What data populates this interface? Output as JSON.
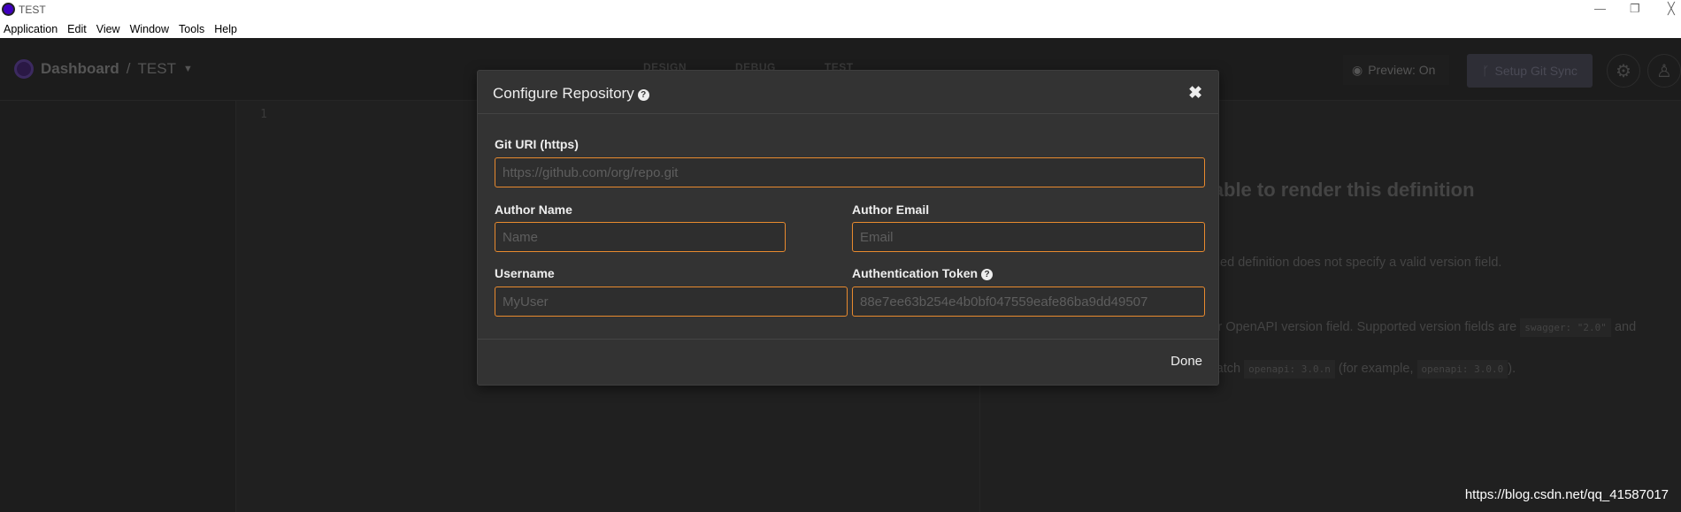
{
  "window": {
    "title": "TEST"
  },
  "menu": [
    "Application",
    "Edit",
    "View",
    "Window",
    "Tools",
    "Help"
  ],
  "header": {
    "breadcrumb_root": "Dashboard",
    "breadcrumb_sep": "/",
    "workspace": "TEST",
    "tabs": [
      "DESIGN",
      "DEBUG",
      "TEST"
    ],
    "preview_label": "Preview: On",
    "git_sync_label": "Setup Git Sync"
  },
  "editor": {
    "line_numbers": [
      "1"
    ]
  },
  "preview_panel": {
    "title": "Unable to render this definition",
    "line1": "The provided definition does not specify a valid version field.",
    "line2a": "Please indicate a valid Swagger or OpenAPI version field. Supported version fields are",
    "code1": "swagger: \"2.0\"",
    "line2b": "and those that match",
    "code2": "openapi: 3.0.n",
    "line2c": "(for example,",
    "code3": "openapi: 3.0.0",
    "line2d": ")."
  },
  "modal": {
    "title": "Configure Repository",
    "close": "✖",
    "git_uri_label": "Git URI (https)",
    "git_uri_placeholder": "https://github.com/org/repo.git",
    "author_name_label": "Author Name",
    "author_name_placeholder": "Name",
    "author_email_label": "Author Email",
    "author_email_placeholder": "Email",
    "username_label": "Username",
    "username_placeholder": "MyUser",
    "token_label": "Authentication Token",
    "token_placeholder": "88e7ee63b254e4b0bf047559eafe86ba9dd49507",
    "done_label": "Done"
  },
  "watermark": "https://blog.csdn.net/qq_41587017",
  "colors": {
    "accent": "#e88a2e",
    "modal_bg": "#333333",
    "app_bg": "#202020"
  }
}
